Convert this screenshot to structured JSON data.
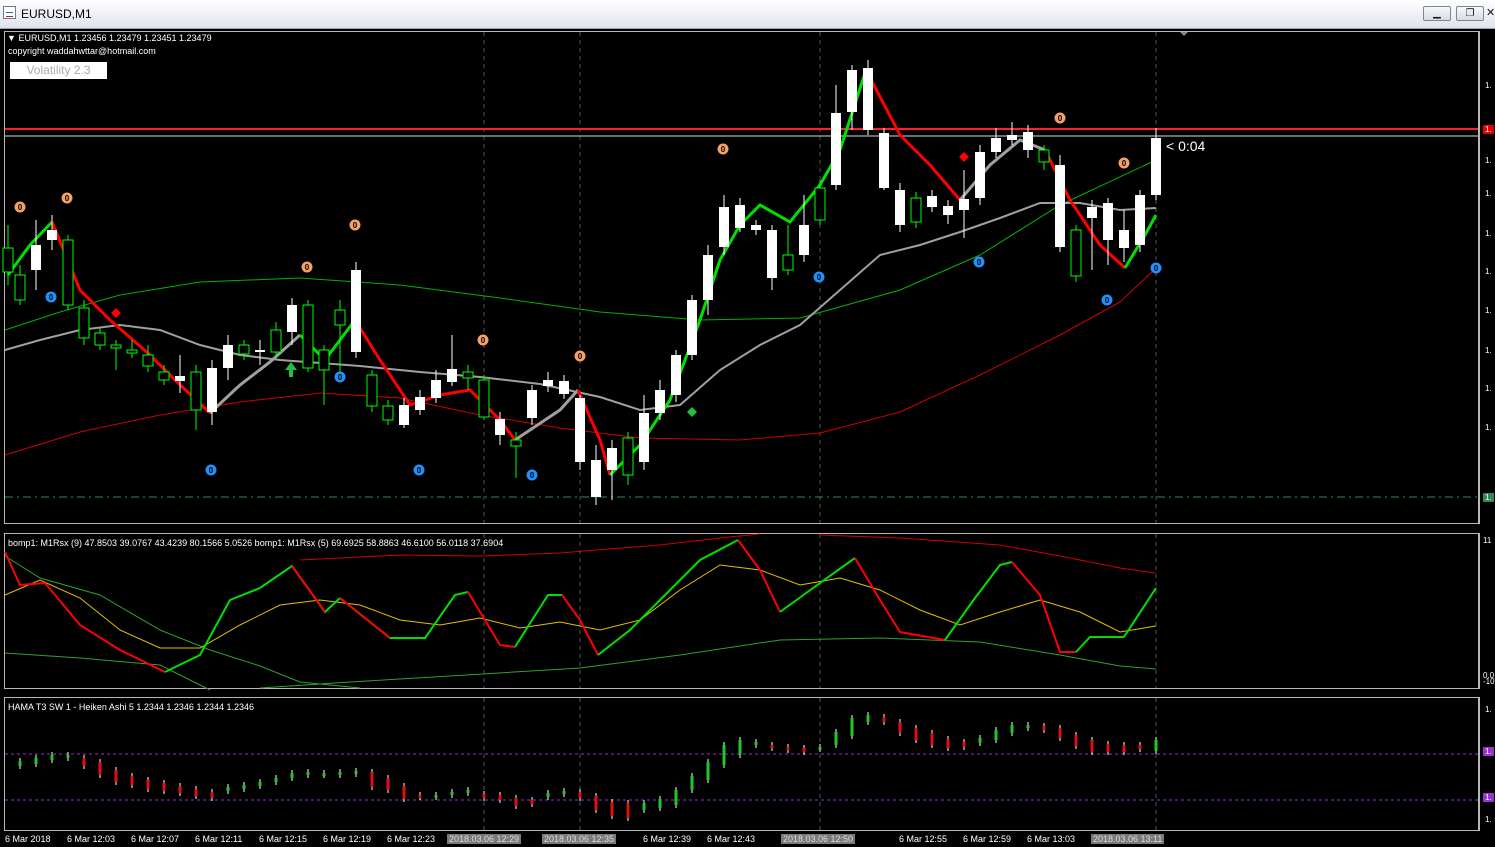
{
  "window": {
    "title": "EURUSD,M1",
    "minimize_label": "▁",
    "restore_label": "❐",
    "close_label": "✕"
  },
  "main_chart": {
    "header": "EURUSD,M1  1.23456 1.23479 1.23451 1.23479",
    "copyright": "copyright waddahwttar@hotmail.com",
    "volatility_label": "Volatility 2.3",
    "timer": "< 0:04",
    "signal_label": "0"
  },
  "indicator1": {
    "label": "bomp1: M1Rsx (9) 47.8503 39.0767 43.4239 80.1566 5.0526  bomp1: M1Rsx (5) 69.6925 58.8863 46.6100 56.0118 37.6904"
  },
  "indicator2": {
    "label": "HAMA T3 SW 1 -  Heiken Ashi 5 1.2344 1.2346 1.2344 1.2346"
  },
  "time_axis": [
    {
      "text": "6 Mar 2018",
      "highlight": false
    },
    {
      "text": "6 Mar 12:03",
      "highlight": false
    },
    {
      "text": "6 Mar 12:07",
      "highlight": false
    },
    {
      "text": "6 Mar 12:11",
      "highlight": false
    },
    {
      "text": "6 Mar 12:15",
      "highlight": false
    },
    {
      "text": "6 Mar 12:19",
      "highlight": false
    },
    {
      "text": "6 Mar 12:23",
      "highlight": false
    },
    {
      "text": "2018.03.06 12:29",
      "highlight": true
    },
    {
      "text": "2018.03.06 12:35",
      "highlight": true
    },
    {
      "text": "6 Mar 12:39",
      "highlight": false
    },
    {
      "text": "6 Mar 12:43",
      "highlight": false
    },
    {
      "text": "2018.03.06 12:50",
      "highlight": true
    },
    {
      "text": "6 Mar 12:55",
      "highlight": false
    },
    {
      "text": "6 Mar 12:59",
      "highlight": false
    },
    {
      "text": "6 Mar 13:03",
      "highlight": false
    },
    {
      "text": "2018.03.06 13:11",
      "highlight": true
    }
  ],
  "price_axis": [
    {
      "text": "1.",
      "highlight": "none"
    },
    {
      "text": "1.",
      "highlight": "red"
    },
    {
      "text": "1.",
      "highlight": "none"
    },
    {
      "text": "1.",
      "highlight": "none"
    },
    {
      "text": "1.",
      "highlight": "none"
    },
    {
      "text": "1.",
      "highlight": "none"
    },
    {
      "text": "1.",
      "highlight": "none"
    },
    {
      "text": "1.",
      "highlight": "none"
    },
    {
      "text": "1.",
      "highlight": "none"
    },
    {
      "text": "1.",
      "highlight": "none"
    },
    {
      "text": "1.",
      "highlight": "green"
    }
  ],
  "indicator1_axis": [
    "11",
    "0.0",
    "-10"
  ],
  "indicator2_axis": [
    "1.",
    "1.",
    "1.",
    "1."
  ],
  "colors": {
    "bull_candle": "#00ff00",
    "bear_candle": "#ffffff",
    "red_line": "#ff0000",
    "green_line": "#00e000",
    "gray_line": "#a0a0a0",
    "signal_orange": "#f5a06a",
    "signal_blue": "#1e90ff"
  }
}
